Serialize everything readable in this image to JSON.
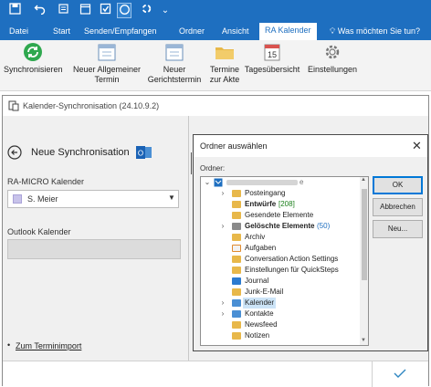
{
  "ribbon_tabs": [
    "Datei",
    "Start",
    "Senden/Empfangen",
    "Ordner",
    "Ansicht",
    "RA Kalender"
  ],
  "tell_me": "Was möchten Sie tun?",
  "ribbon_buttons": [
    {
      "line1": "Synchronisieren",
      "line2": ""
    },
    {
      "line1": "Neuer Allgemeiner",
      "line2": "Termin"
    },
    {
      "line1": "Neuer",
      "line2": "Gerichtstermin"
    },
    {
      "line1": "Termine",
      "line2": "zur Akte"
    },
    {
      "line1": "Tagesübersicht",
      "line2": ""
    },
    {
      "line1": "Einstellungen",
      "line2": ""
    }
  ],
  "calendar_day": "15",
  "sync_window": {
    "title": "Kalender-Synchronisation (24.10.9.2)",
    "heading": "Neue Synchronisation",
    "ra_micro_label": "RA-MICRO Kalender",
    "ra_micro_value": "S. Meier",
    "outlook_label": "Outlook Kalender",
    "outlook_value": "",
    "link": "Zum Terminimport"
  },
  "dialog": {
    "title": "Ordner auswählen",
    "ordner_label": "Ordner:",
    "tree": [
      {
        "label": "Posteingang",
        "bold": false,
        "count": "",
        "expander": "›",
        "icon": "folder"
      },
      {
        "label": "Entwürfe",
        "bold": true,
        "count": "[208]",
        "expander": "",
        "icon": "drafts"
      },
      {
        "label": "Gesendete Elemente",
        "bold": false,
        "count": "",
        "expander": "",
        "icon": "folder"
      },
      {
        "label": "Gelöschte Elemente",
        "bold": true,
        "count": "(50)",
        "expander": "›",
        "icon": "trash"
      },
      {
        "label": "Archiv",
        "bold": false,
        "count": "",
        "expander": "",
        "icon": "folder"
      },
      {
        "label": "Aufgaben",
        "bold": false,
        "count": "",
        "expander": "",
        "icon": "tasks"
      },
      {
        "label": "Conversation Action Settings",
        "bold": false,
        "count": "",
        "expander": "",
        "icon": "folder"
      },
      {
        "label": "Einstellungen für QuickSteps",
        "bold": false,
        "count": "",
        "expander": "",
        "icon": "folder"
      },
      {
        "label": "Journal",
        "bold": false,
        "count": "",
        "expander": "",
        "icon": "journal"
      },
      {
        "label": "Junk-E-Mail",
        "bold": false,
        "count": "",
        "expander": "",
        "icon": "junk"
      },
      {
        "label": "Kalender",
        "bold": false,
        "count": "",
        "expander": "›",
        "icon": "calendar",
        "selected": true
      },
      {
        "label": "Kontakte",
        "bold": false,
        "count": "",
        "expander": "›",
        "icon": "contacts"
      },
      {
        "label": "Newsfeed",
        "bold": false,
        "count": "",
        "expander": "",
        "icon": "folder"
      },
      {
        "label": "Notizen",
        "bold": false,
        "count": "",
        "expander": "",
        "icon": "folder"
      }
    ],
    "ok": "OK",
    "cancel": "Abbrechen",
    "new": "Neu..."
  },
  "colors": {
    "accent": "#1e6fc0",
    "sync_green": "#2fa84f",
    "selection": "#cce4f7",
    "count": "#1a7f1a",
    "check": "#2e86c1"
  }
}
